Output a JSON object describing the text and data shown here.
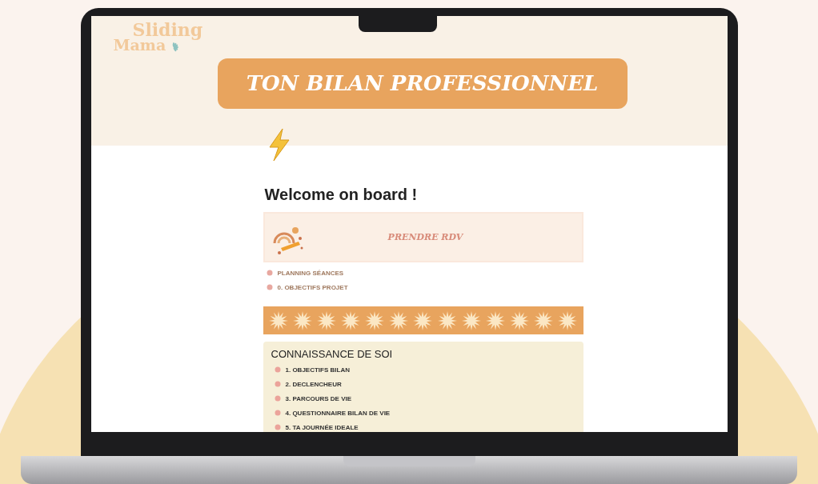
{
  "logo": {
    "line_1": "Sliding",
    "line_2": "Mama"
  },
  "banner": {
    "title": "TON BILAN PROFESSIONNEL"
  },
  "heading": "Welcome on board !",
  "callout": {
    "label": "PRENDRE RDV"
  },
  "links": [
    "PLANNING SÉANCES",
    "0. OBJECTIFS PROJET"
  ],
  "section": {
    "title": "CONNAISSANCE DE SOI",
    "items": [
      "1. OBJECTIFS BILAN",
      "2. DECLENCHEUR",
      "3. PARCOURS DE VIE",
      "4. QUESTIONNAIRE BILAN DE VIE",
      "5. TA JOURNÉE IDEALE"
    ]
  }
}
